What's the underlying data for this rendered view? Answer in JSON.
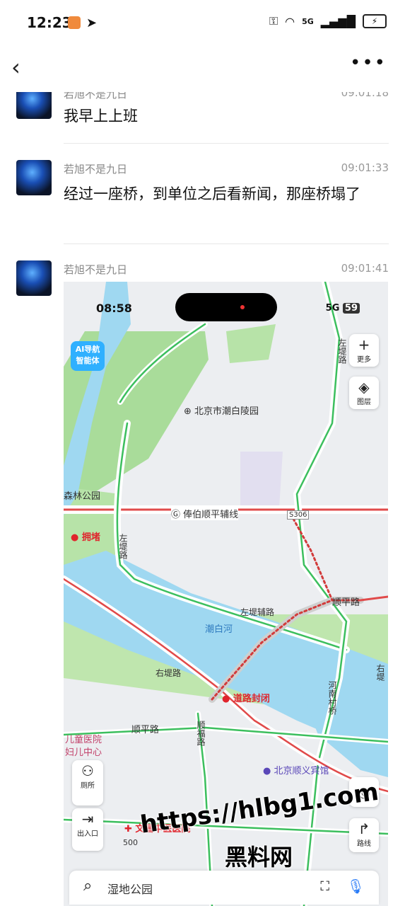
{
  "status_bar": {
    "time": "12:23",
    "network": "5G",
    "icons": [
      "app-badge-icon",
      "telegram-icon",
      "key-icon",
      "wifi-icon",
      "signal-icon",
      "battery-icon"
    ]
  },
  "nav": {
    "back_icon": "‹",
    "more_icon": "•••"
  },
  "messages": [
    {
      "sender": "若旭不是九日",
      "time": "09:01:18",
      "text": "我早上上班"
    },
    {
      "sender": "若旭不是九日",
      "time": "09:01:33",
      "text": "经过一座桥，到单位之后看新闻，那座桥塌了"
    },
    {
      "sender": "若旭不是九日",
      "time": "09:01:41"
    }
  ],
  "map_screenshot": {
    "time": "08:58",
    "network": "5G",
    "battery": "59",
    "ai_badge_line1": "AI导航",
    "ai_badge_line2": "智能体",
    "buttons": {
      "more": "更多",
      "layers": "图层",
      "toilet": "厕所",
      "entrance": "出入口",
      "route": "路线"
    },
    "labels": {
      "park": "北京市潮白陵园",
      "forest": "森林公园",
      "congestion": "拥堵",
      "road_main": "俸伯顺平辅线",
      "road_code": "S306",
      "left_bank_road": "左堤路",
      "left_bank_aux": "左堤辅路",
      "chaobai_river": "潮白河",
      "shunping_road": "顺平路",
      "shunping_road2": "顺平路",
      "right_bank_road": "右堤路",
      "right_bank2": "右堤",
      "road_closed": "道路封闭",
      "hebei_bridge": "河南村桥",
      "children_hospital": "儿童医院",
      "maternity": "妇儿中心",
      "shunfu_road": "顺福路",
      "hotel": "北京顺义宾馆",
      "wenchang_hospital": "文昌中医医院",
      "scale": "500"
    },
    "search_placeholder": "湿地公园"
  },
  "watermark": {
    "line1": "https://hlbg1.com",
    "line2": "黑料网"
  }
}
